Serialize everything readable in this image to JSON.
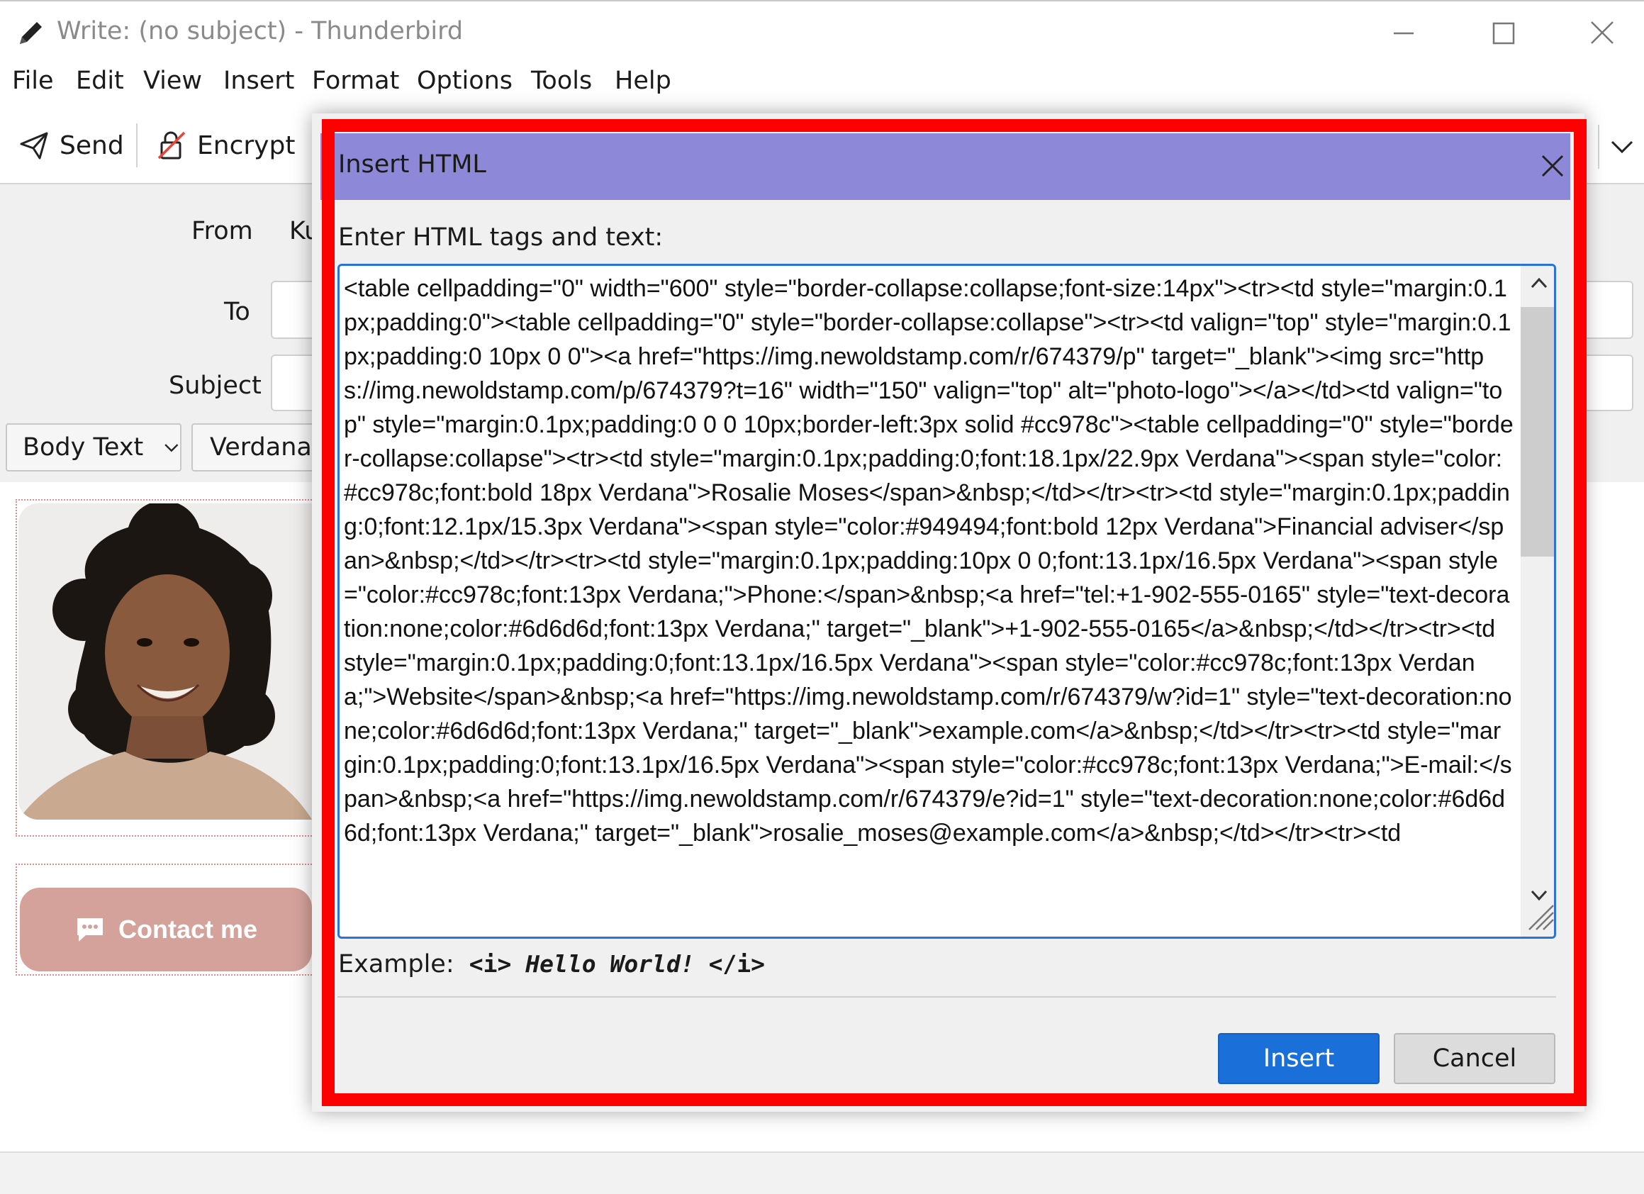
{
  "window": {
    "title": "Write: (no subject) - Thunderbird"
  },
  "menubar": {
    "items": [
      {
        "label": "File"
      },
      {
        "label": "Edit"
      },
      {
        "label": "View"
      },
      {
        "label": "Insert"
      },
      {
        "label": "Format"
      },
      {
        "label": "Options"
      },
      {
        "label": "Tools"
      },
      {
        "label": "Help"
      }
    ]
  },
  "toolbar": {
    "send_label": "Send",
    "encrypt_label": "Encrypt"
  },
  "header": {
    "from_label": "From",
    "from_value": "Ku",
    "to_label": "To",
    "subject_label": "Subject"
  },
  "format_bar": {
    "paragraph_style": "Body Text",
    "font": "Verdana"
  },
  "signature": {
    "contact_button_label": "Contact me",
    "accent_color": "#d4a29a"
  },
  "dialog": {
    "title": "Insert HTML",
    "prompt": "Enter HTML tags and text:",
    "html_value": "<table cellpadding=\"0\" width=\"600\" style=\"border-collapse:collapse;font-size:14px\"><tr><td style=\"margin:0.1px;padding:0\"><table cellpadding=\"0\" style=\"border-collapse:collapse\"><tr><td valign=\"top\" style=\"margin:0.1px;padding:0 10px 0 0\"><a href=\"https://img.newoldstamp.com/r/674379/p\" target=\"_blank\"><img src=\"https://img.newoldstamp.com/p/674379?t=16\" width=\"150\" valign=\"top\" alt=\"photo-logo\"></a></td><td valign=\"top\" style=\"margin:0.1px;padding:0 0 0 10px;border-left:3px solid #cc978c\"><table cellpadding=\"0\" style=\"border-collapse:collapse\"><tr><td style=\"margin:0.1px;padding:0;font:18.1px/22.9px Verdana\"><span style=\"color:#cc978c;font:bold 18px Verdana\">Rosalie Moses</span>&nbsp;</td></tr><tr><td style=\"margin:0.1px;padding:0;font:12.1px/15.3px Verdana\"><span style=\"color:#949494;font:bold 12px Verdana\">Financial adviser</span>&nbsp;</td></tr><tr><td style=\"margin:0.1px;padding:10px 0 0;font:13.1px/16.5px Verdana\"><span style=\"color:#cc978c;font:13px Verdana;\">Phone:</span>&nbsp;<a href=\"tel:+1-902-555-0165\" style=\"text-decoration:none;color:#6d6d6d;font:13px Verdana;\" target=\"_blank\">+1-902-555-0165</a>&nbsp;</td></tr><tr><td style=\"margin:0.1px;padding:0;font:13.1px/16.5px Verdana\"><span style=\"color:#cc978c;font:13px Verdana;\">Website</span>&nbsp;<a href=\"https://img.newoldstamp.com/r/674379/w?id=1\" style=\"text-decoration:none;color:#6d6d6d;font:13px Verdana;\" target=\"_blank\">example.com</a>&nbsp;</td></tr><tr><td style=\"margin:0.1px;padding:0;font:13.1px/16.5px Verdana\"><span style=\"color:#cc978c;font:13px Verdana;\">E-mail:</span>&nbsp;<a href=\"https://img.newoldstamp.com/r/674379/e?id=1\" style=\"text-decoration:none;color:#6d6d6d;font:13px Verdana;\" target=\"_blank\">rosalie_moses@example.com</a>&nbsp;</td></tr><tr><td",
    "example_label": "Example:",
    "example_code_open": "<i>",
    "example_code_text": "Hello World!",
    "example_code_close": "</i>",
    "insert_label": "Insert",
    "cancel_label": "Cancel",
    "titlebar_color": "#8d88d8",
    "insert_button_color": "#1a6fd9",
    "highlight_color": "#ff0000"
  }
}
